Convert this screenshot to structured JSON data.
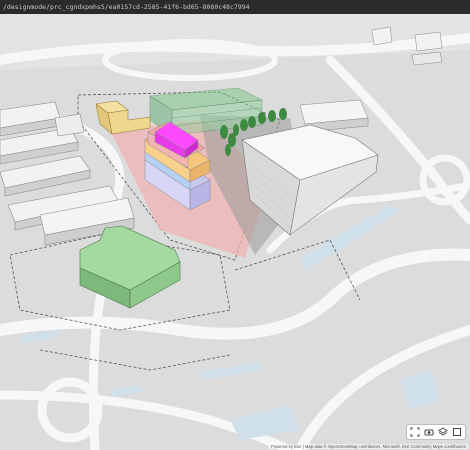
{
  "address_bar": {
    "url": "/designmode/prc_cgndxpmhs5/ea0157cd-2585-41f6-bd65-8080c48c7994"
  },
  "viewport_toolbar": {
    "buttons": [
      {
        "name": "fit-view-icon",
        "icon": "frame"
      },
      {
        "name": "camera-icon",
        "icon": "camera"
      },
      {
        "name": "layers-icon",
        "icon": "layers"
      },
      {
        "name": "fullscreen-icon",
        "icon": "expand"
      }
    ]
  },
  "attribution": "Powered by Esri  |  Map data © OpenStreetMap contributors, Microsoft, Esri Community Maps contributors"
}
